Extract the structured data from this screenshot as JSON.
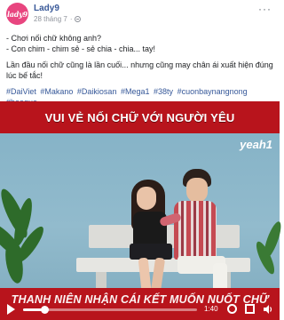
{
  "post": {
    "page_name": "Lady9",
    "avatar_text": "lady9",
    "timestamp": "28 tháng 7",
    "privacy_icon": "globe-icon",
    "more_icon": "more-icon",
    "lines": [
      "- Chơi nối chữ không anh?",
      "- Con chim - chim sẻ - sẻ chia - chia... tay!"
    ],
    "paragraph": "Lần đầu nối chữ cũng là lần cuối... nhưng cũng may chân ái xuất hiện đúng lúc bế tắc!",
    "hashtags": [
      "#DaiViet",
      "#Makano",
      "#Daikiosan",
      "#Mega1",
      "#38ty",
      "#cuonbaynangnong",
      "#baoqua"
    ]
  },
  "video": {
    "top_caption": "VUI VẺ NỐI CHỮ VỚI NGƯỜI YÊU",
    "brand_logo": "yeah1",
    "bottom_caption": "THANH NIÊN NHẬN CÁI KẾT MUỐN NUỐT CHỮ",
    "controls": {
      "time": "1:40",
      "progress": 0.12,
      "icons": [
        "play-icon",
        "settings-icon",
        "fullscreen-icon",
        "volume-icon"
      ]
    }
  },
  "colors": {
    "link": "#365899",
    "page_name": "#385898",
    "avatar": "#e8457f",
    "caption_band": "#b8141c"
  }
}
